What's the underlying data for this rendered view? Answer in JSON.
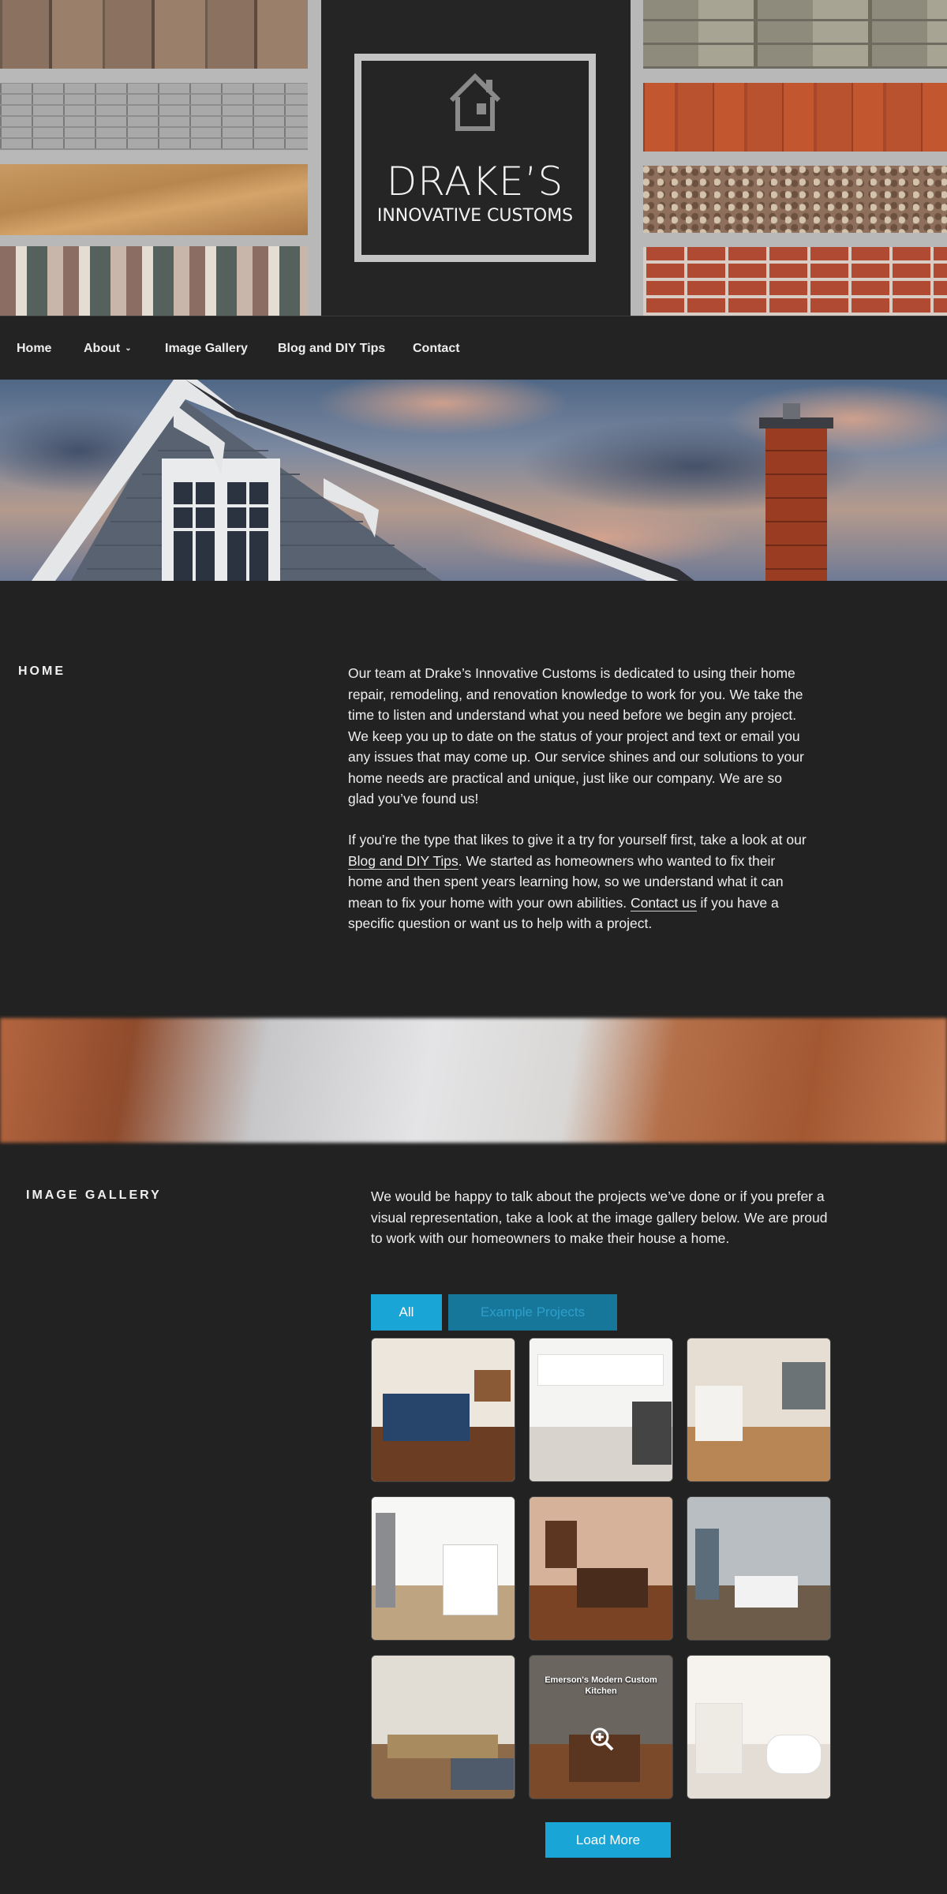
{
  "header": {
    "logo_name": "DRAKE’S",
    "logo_subtitle": "INNOVATIVE CUSTOMS"
  },
  "nav": {
    "items": [
      {
        "label": "Home",
        "has_dropdown": false
      },
      {
        "label": "About",
        "has_dropdown": true
      },
      {
        "label": "Image Gallery",
        "has_dropdown": false
      },
      {
        "label": "Blog and DIY Tips",
        "has_dropdown": false
      },
      {
        "label": "Contact",
        "has_dropdown": false
      }
    ]
  },
  "home": {
    "title": "HOME",
    "para1": "Our team at Drake’s Innovative Customs is dedicated to using their home repair, remodeling, and renovation knowledge to work for you. We take the time to listen and understand what you need before we begin any project. We keep you up to date on the status of your project and text or email you any issues that may come up. Our service shines and our solutions to your home needs are practical and unique, just like our company. We are so glad you’ve found us!",
    "para2_before": "If you’re the type that likes to give it a try for yourself first, take a look at our ",
    "para2_link1": "Blog and DIY Tips",
    "para2_middle": ". We started as homeowners who wanted to fix their home and then spent years learning how, so we understand what it can mean to fix your home with your own abilities. ",
    "para2_link2": "Contact us",
    "para2_after": " if you have a specific question or want us to help with a project."
  },
  "gallery": {
    "title": "IMAGE GALLERY",
    "intro": "We would be happy to talk about the projects we’ve done or if you prefer a visual representation, take a look at the image gallery below. We are proud to work with our homeowners to make their house a home.",
    "filters": [
      {
        "label": "All",
        "active": true
      },
      {
        "label": "Example Projects",
        "active": false
      }
    ],
    "hover_title": "Emerson's Modern Custom Kitchen",
    "load_more": "Load More",
    "accent": "#19a5d6"
  }
}
